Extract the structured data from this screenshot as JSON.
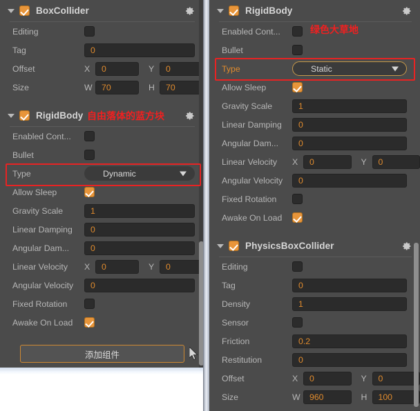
{
  "left_panel": {
    "components": [
      {
        "name": "BoxCollider",
        "enabled": true,
        "gear_icon": "gear-icon",
        "properties": [
          {
            "label": "Editing",
            "type": "checkbox",
            "checked": false
          },
          {
            "label": "Tag",
            "type": "text",
            "value": "0"
          },
          {
            "label": "Offset",
            "type": "xy",
            "x_label": "X",
            "x_value": "0",
            "y_label": "Y",
            "y_value": "0"
          },
          {
            "label": "Size",
            "type": "xy",
            "x_label": "W",
            "x_value": "70",
            "y_label": "H",
            "y_value": "70"
          }
        ]
      },
      {
        "name": "RigidBody",
        "enabled": true,
        "gear_icon": "gear-icon",
        "annotation": "自由落体的蓝方块",
        "properties": [
          {
            "label": "Enabled Cont...",
            "type": "checkbox",
            "checked": false
          },
          {
            "label": "Bullet",
            "type": "checkbox",
            "checked": false
          },
          {
            "label": "Type",
            "type": "dropdown",
            "value": "Dynamic",
            "highlighted": true,
            "focused": false
          },
          {
            "label": "Allow Sleep",
            "type": "checkbox",
            "checked": true
          },
          {
            "label": "Gravity Scale",
            "type": "text",
            "value": "1"
          },
          {
            "label": "Linear Damping",
            "type": "text",
            "value": "0"
          },
          {
            "label": "Angular Dam...",
            "type": "text",
            "value": "0"
          },
          {
            "label": "Linear Velocity",
            "type": "xy",
            "x_label": "X",
            "x_value": "0",
            "y_label": "Y",
            "y_value": "0"
          },
          {
            "label": "Angular Velocity",
            "type": "text",
            "value": "0"
          },
          {
            "label": "Fixed Rotation",
            "type": "checkbox",
            "checked": false
          },
          {
            "label": "Awake On Load",
            "type": "checkbox",
            "checked": true
          }
        ]
      }
    ],
    "add_component_button": "添加组件"
  },
  "right_panel": {
    "components": [
      {
        "name": "RigidBody",
        "enabled": true,
        "gear_icon": "gear-icon",
        "annotation": "绿色大草地",
        "properties": [
          {
            "label": "Enabled Cont...",
            "type": "checkbox",
            "checked": false
          },
          {
            "label": "Bullet",
            "type": "checkbox",
            "checked": false
          },
          {
            "label": "Type",
            "type": "dropdown",
            "value": "Static",
            "highlighted": true,
            "focused": true
          },
          {
            "label": "Allow Sleep",
            "type": "checkbox",
            "checked": true
          },
          {
            "label": "Gravity Scale",
            "type": "text",
            "value": "1"
          },
          {
            "label": "Linear Damping",
            "type": "text",
            "value": "0"
          },
          {
            "label": "Angular Dam...",
            "type": "text",
            "value": "0"
          },
          {
            "label": "Linear Velocity",
            "type": "xy",
            "x_label": "X",
            "x_value": "0",
            "y_label": "Y",
            "y_value": "0"
          },
          {
            "label": "Angular Velocity",
            "type": "text",
            "value": "0"
          },
          {
            "label": "Fixed Rotation",
            "type": "checkbox",
            "checked": false
          },
          {
            "label": "Awake On Load",
            "type": "checkbox",
            "checked": true
          }
        ]
      },
      {
        "name": "PhysicsBoxCollider",
        "enabled": true,
        "gear_icon": "gear-icon",
        "properties": [
          {
            "label": "Editing",
            "type": "checkbox",
            "checked": false
          },
          {
            "label": "Tag",
            "type": "text",
            "value": "0"
          },
          {
            "label": "Density",
            "type": "text",
            "value": "1"
          },
          {
            "label": "Sensor",
            "type": "checkbox",
            "checked": false
          },
          {
            "label": "Friction",
            "type": "text",
            "value": "0.2"
          },
          {
            "label": "Restitution",
            "type": "text",
            "value": "0"
          },
          {
            "label": "Offset",
            "type": "xy",
            "x_label": "X",
            "x_value": "0",
            "y_label": "Y",
            "y_value": "0"
          },
          {
            "label": "Size",
            "type": "xy",
            "x_label": "W",
            "x_value": "960",
            "y_label": "H",
            "y_value": "100"
          }
        ]
      }
    ]
  },
  "colors": {
    "panel_bg": "#4b4b4b",
    "field_bg": "#2b2b2b",
    "value_text": "#e08b2d",
    "label_text": "#b7b7b7",
    "accent_orange": "#e8953a",
    "annotation_red": "#f02020"
  }
}
